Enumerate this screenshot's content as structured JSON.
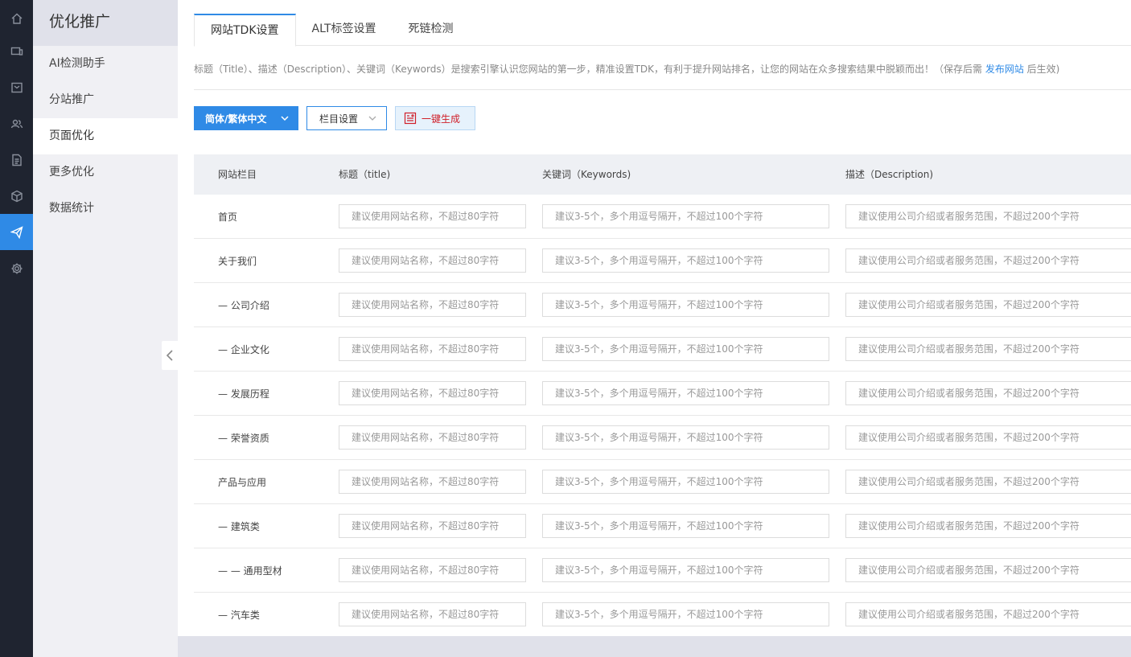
{
  "rail": {
    "items": [
      {
        "icon": "home-icon"
      },
      {
        "icon": "devices-icon"
      },
      {
        "icon": "mail-icon"
      },
      {
        "icon": "users-icon"
      },
      {
        "icon": "document-icon"
      },
      {
        "icon": "cube-icon"
      },
      {
        "icon": "send-icon",
        "active": true
      },
      {
        "icon": "gear-icon"
      }
    ]
  },
  "sidebar": {
    "title": "优化推广",
    "items": [
      {
        "label": "AI检测助手"
      },
      {
        "label": "分站推广"
      },
      {
        "label": "页面优化",
        "active": true
      },
      {
        "label": "更多优化"
      },
      {
        "label": "数据统计"
      }
    ]
  },
  "tabs": [
    {
      "label": "网站TDK设置",
      "active": true
    },
    {
      "label": "ALT标签设置"
    },
    {
      "label": "死链检测"
    }
  ],
  "notice": {
    "text": "标题（Title）、描述（Description）、关键词（Keywords）是搜索引擎认识您网站的第一步，精准设置TDK，有利于提升网站排名，让您的网站在众多搜索结果中脱颖而出！（保存后需 ",
    "link": "发布网站",
    "suffix": " 后生效)"
  },
  "toolbar": {
    "lang_label": "简体/繁体中文",
    "column_label": "栏目设置",
    "generate_label": "一键生成"
  },
  "table": {
    "headers": {
      "column": "网站栏目",
      "title": "标题（title)",
      "keywords": "关键词（Keywords)",
      "description": "描述（Description)"
    },
    "placeholders": {
      "title": "建议使用网站名称，不超过80字符",
      "keywords": "建议3-5个，多个用逗号隔开，不超过100个字符",
      "description": "建议使用公司介绍或者服务范围，不超过200个字符"
    },
    "rows": [
      {
        "name": "首页"
      },
      {
        "name": "关于我们"
      },
      {
        "name": "— 公司介绍"
      },
      {
        "name": "— 企业文化"
      },
      {
        "name": "— 发展历程"
      },
      {
        "name": "— 荣誉资质"
      },
      {
        "name": "产品与应用"
      },
      {
        "name": "— 建筑类"
      },
      {
        "name": "— — 通用型材"
      },
      {
        "name": "— 汽车类"
      }
    ]
  },
  "colors": {
    "accent": "#2f8ae6",
    "rail_bg": "#1f2430",
    "generate_red": "#d0202a"
  }
}
